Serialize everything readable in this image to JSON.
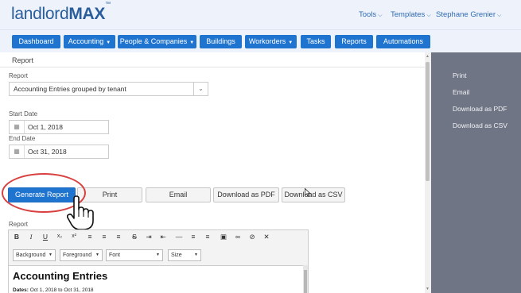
{
  "header": {
    "logo_main": "landlord",
    "logo_bold": "MAX",
    "logo_tm": "™",
    "menu": [
      {
        "label": "Tools"
      },
      {
        "label": "Templates"
      },
      {
        "label": "Stephane Grenier"
      }
    ]
  },
  "nav": [
    {
      "label": "Dashboard",
      "dropdown": false
    },
    {
      "label": "Accounting",
      "dropdown": true
    },
    {
      "label": "People & Companies",
      "dropdown": true
    },
    {
      "label": "Buildings",
      "dropdown": false
    },
    {
      "label": "Workorders",
      "dropdown": true
    },
    {
      "label": "Tasks",
      "dropdown": false
    },
    {
      "label": "Reports",
      "dropdown": false
    },
    {
      "label": "Automations",
      "dropdown": false
    }
  ],
  "page": {
    "title": "Report",
    "report_label": "Report",
    "report_value": "Accounting Entries grouped by tenant",
    "start_label": "Start Date",
    "start_value": "Oct 1, 2018",
    "end_label": "End Date",
    "end_value": "Oct 31, 2018",
    "editor_label": "Report"
  },
  "actions": {
    "generate": "Generate Report",
    "print": "Print",
    "email": "Email",
    "pdf": "Download as PDF",
    "csv": "Download as CSV"
  },
  "editor": {
    "dropdowns": {
      "background": "Background",
      "foreground": "Foreground",
      "font": "Font",
      "size": "Size"
    },
    "doc_title": "Accounting Entries",
    "dates_label": "Dates:",
    "dates_value": "Oct 1, 2018 to Oct 31, 2018"
  },
  "sidebar": {
    "items": [
      {
        "label": "Print"
      },
      {
        "label": "Email"
      },
      {
        "label": "Download as PDF"
      },
      {
        "label": "Download as CSV"
      }
    ]
  },
  "colors": {
    "accent": "#1f74d0",
    "sidebar": "#6f7585",
    "highlight": "#d8403f"
  }
}
